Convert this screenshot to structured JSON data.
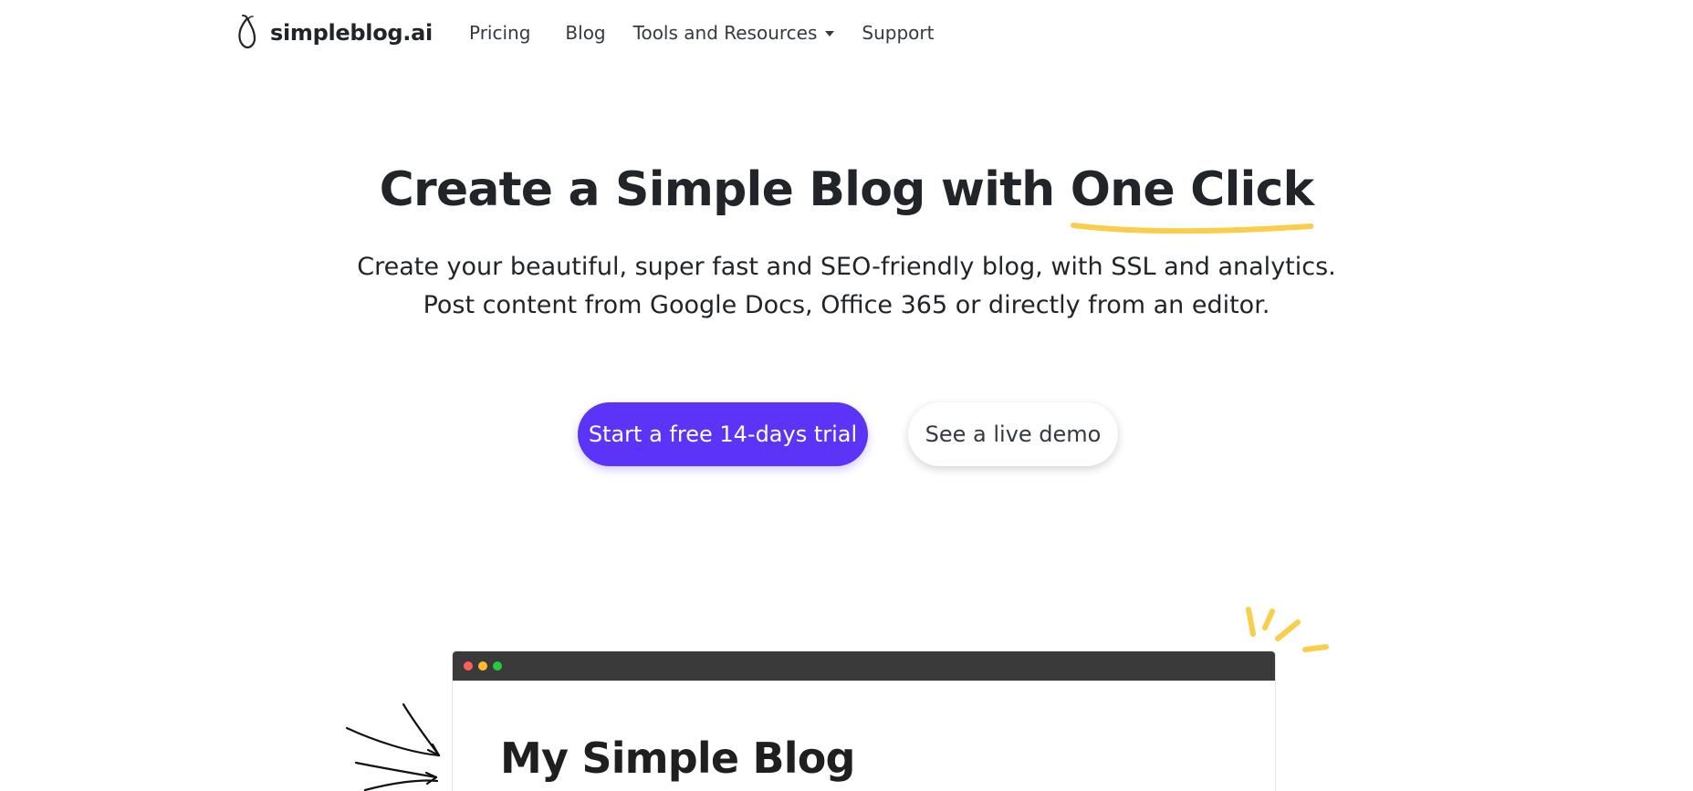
{
  "brand": {
    "name": "simpleblog.ai",
    "icon": "leaf-icon"
  },
  "nav": {
    "items": [
      {
        "label": "Pricing"
      },
      {
        "label": "Blog"
      },
      {
        "label": "Tools and Resources",
        "has_dropdown": true
      },
      {
        "label": "Support"
      }
    ]
  },
  "hero": {
    "title_prefix": "Create a Simple Blog with ",
    "title_highlight": "One Click",
    "subtitle_line1": "Create your beautiful, super fast and SEO-friendly blog, with SSL and analytics.",
    "subtitle_line2": "Post content from Google Docs, Office 365 or directly from an editor."
  },
  "cta": {
    "primary_label": "Start a free 14-days trial",
    "secondary_label": "See a live demo"
  },
  "mockup": {
    "title": "My Simple Blog",
    "dot_colors": [
      "#ff5f57",
      "#febc2e",
      "#28c840"
    ]
  },
  "colors": {
    "accent": "#5b34f7",
    "highlight": "#f9ce4a"
  }
}
